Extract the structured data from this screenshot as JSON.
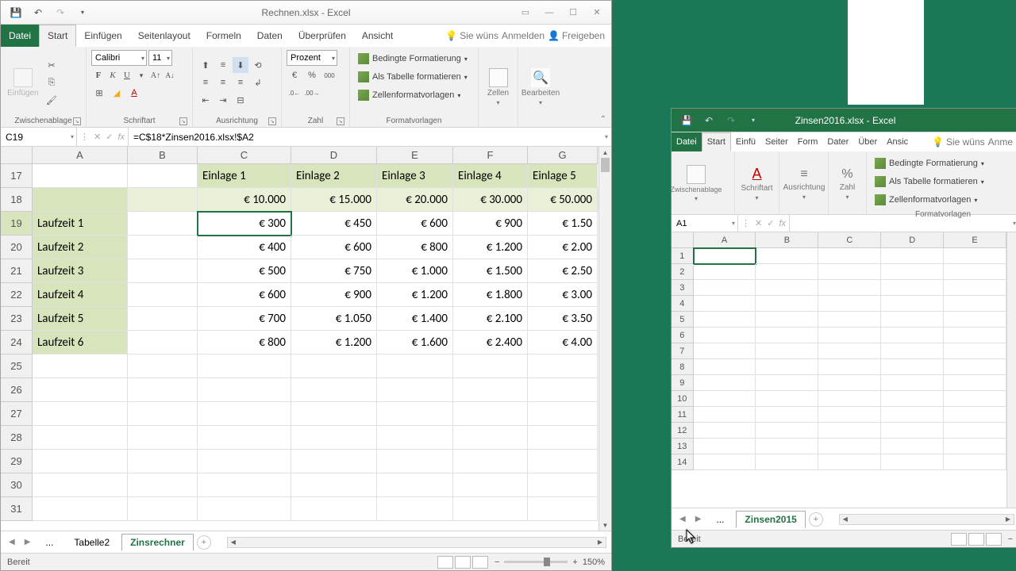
{
  "win1": {
    "title": "Rechnen.xlsx - Excel",
    "menu": {
      "file": "Datei",
      "start": "Start",
      "einfugen": "Einfügen",
      "seitenlayout": "Seitenlayout",
      "formeln": "Formeln",
      "daten": "Daten",
      "uberprufen": "Überprüfen",
      "ansicht": "Ansicht",
      "siewuns": "Sie wüns",
      "anmelden": "Anmelden",
      "freigeben": "Freigeben"
    },
    "ribbon": {
      "zwischenablage": "Zwischenablage",
      "einfugen": "Einfügen",
      "schriftart": "Schriftart",
      "ausrichtung": "Ausrichtung",
      "zahl": "Zahl",
      "formatvorlagen": "Formatvorlagen",
      "zellen": "Zellen",
      "bearbeiten": "Bearbeiten",
      "font_name": "Calibri",
      "font_size": "11",
      "number_format": "Prozent",
      "bedingte": "Bedingte Formatierung",
      "alsTabelle": "Als Tabelle formatieren",
      "zellenformat": "Zellenformatvorlagen"
    },
    "namebox": "C19",
    "formula": "=C$18*Zinsen2016.xlsx!$A2",
    "cols": [
      "A",
      "B",
      "C",
      "D",
      "E",
      "F",
      "G"
    ],
    "row_start": 17,
    "headers": [
      "",
      "",
      "Einlage 1",
      "Einlage 2",
      "Einlage 3",
      "Einlage 4",
      "Einlage 5"
    ],
    "amounts": [
      "",
      "",
      "€ 10.000",
      "€ 15.000",
      "€ 20.000",
      "€ 30.000",
      "€ 50.000"
    ],
    "data": [
      [
        "Laufzeit 1",
        "",
        "€ 300",
        "€ 450",
        "€ 600",
        "€ 900",
        "€ 1.50"
      ],
      [
        "Laufzeit 2",
        "",
        "€ 400",
        "€ 600",
        "€ 800",
        "€ 1.200",
        "€ 2.00"
      ],
      [
        "Laufzeit 3",
        "",
        "€ 500",
        "€ 750",
        "€ 1.000",
        "€ 1.500",
        "€ 2.50"
      ],
      [
        "Laufzeit 4",
        "",
        "€ 600",
        "€ 900",
        "€ 1.200",
        "€ 1.800",
        "€ 3.00"
      ],
      [
        "Laufzeit 5",
        "",
        "€ 700",
        "€ 1.050",
        "€ 1.400",
        "€ 2.100",
        "€ 3.50"
      ],
      [
        "Laufzeit 6",
        "",
        "€ 800",
        "€ 1.200",
        "€ 1.600",
        "€ 2.400",
        "€ 4.00"
      ]
    ],
    "sheets": {
      "ellipsis": "...",
      "t1": "Tabelle2",
      "t2": "Zinsrechner"
    },
    "status": "Bereit",
    "zoom": "150%"
  },
  "win2": {
    "title": "Zinsen2016.xlsx - Excel",
    "menu": {
      "file": "Datei",
      "start": "Start",
      "einfu": "Einfü",
      "seiter": "Seiter",
      "form": "Form",
      "dater": "Dater",
      "uber": "Über",
      "ansic": "Ansic",
      "siewuns": "Sie wüns",
      "anme": "Anme"
    },
    "ribbon": {
      "zwischenablage": "Zwischenablage",
      "schriftart": "Schriftart",
      "ausrichtung": "Ausrichtung",
      "zahl": "Zahl",
      "formatvorlagen": "Formatvorlagen",
      "bedingte": "Bedingte Formatierung",
      "alsTabelle": "Als Tabelle formatieren",
      "zellenformat": "Zellenformatvorlagen"
    },
    "namebox": "A1",
    "cols": [
      "A",
      "B",
      "C",
      "D",
      "E"
    ],
    "rows": 14,
    "sheets": {
      "ellipsis": "...",
      "t1": "Zinsen2015"
    },
    "status": "Bereit"
  }
}
